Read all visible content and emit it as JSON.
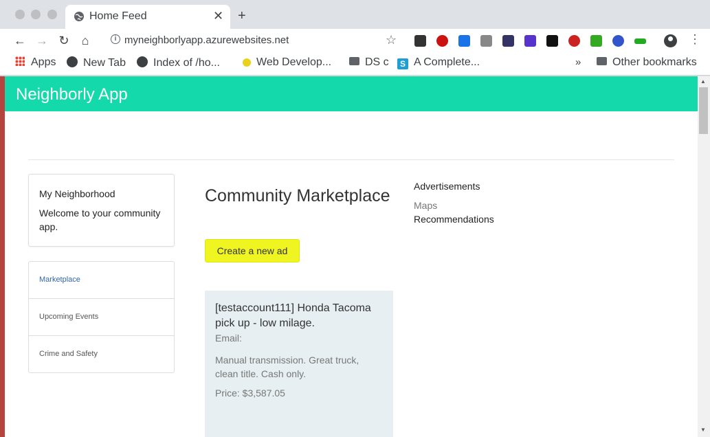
{
  "browser": {
    "tab_title": "Home Feed",
    "tab_close": "✕",
    "new_tab": "+",
    "url": "myneighborlyapp.azurewebsites.net",
    "bookmarks": [
      {
        "label": "Apps",
        "icon": "apps-grid-icon"
      },
      {
        "label": "New Tab",
        "icon": "globe-icon"
      },
      {
        "label": "Index of /ho...",
        "icon": "globe-icon"
      },
      {
        "label": "Web Develop...",
        "icon": "bookmark-favicon"
      },
      {
        "label": "DS c",
        "icon": "folder-icon"
      },
      {
        "label": "A Complete...",
        "icon": "s-favicon"
      }
    ],
    "more_bookmarks": "»",
    "other_bookmarks": "Other bookmarks",
    "extension_colors": [
      "#333333",
      "#cc1111",
      "#1a73e8",
      "#888888",
      "#333366",
      "#5533cc",
      "#111111",
      "#cc2222",
      "#33aa22",
      "#3355cc",
      "#22aa22"
    ]
  },
  "app": {
    "title": "Neighborly App",
    "accent": "#14d9aa",
    "card": {
      "title": "My Neighborhood",
      "text": "Welcome to your community app."
    },
    "nav": [
      {
        "label": "Marketplace",
        "active": true
      },
      {
        "label": "Upcoming Events",
        "active": false
      },
      {
        "label": "Crime and Safety",
        "active": false
      }
    ],
    "main": {
      "heading": "Community Marketplace",
      "create_button": "Create a new ad",
      "ad": {
        "title": "[testaccount111] Honda Tacoma pick up - low milage.",
        "email": "Email:",
        "description": "Manual transmission. Great truck, clean title. Cash only.",
        "price": "Price: $3,587.05"
      }
    },
    "sidebar": {
      "heading": "Advertisements",
      "maps": "Maps",
      "recommendations": "Recommendations"
    }
  }
}
